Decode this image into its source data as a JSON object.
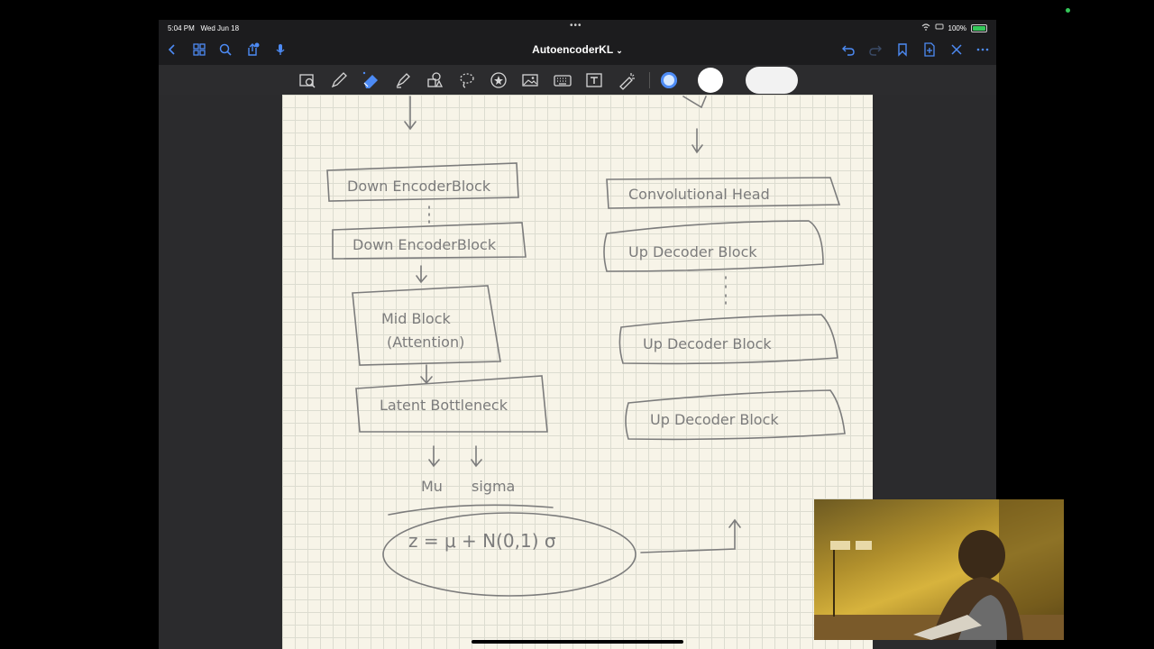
{
  "status_bar": {
    "time": "5:04 PM",
    "date": "Wed Jun 18",
    "battery": "100%",
    "multitask_dots": "•••"
  },
  "nav": {
    "title": "AutoencoderKL",
    "title_chevron": "⌄",
    "accent_color": "#4d8bf5"
  },
  "toolbar": {
    "tools": [
      "zoom-window-icon",
      "pen-icon",
      "eraser-icon",
      "highlighter-icon",
      "shapes-icon",
      "lasso-icon",
      "sticker-icon",
      "image-icon",
      "keyboard-icon",
      "text-icon",
      "laser-pointer-icon"
    ],
    "colors": [
      "#d6e8ff",
      "#ffffff",
      "#f2f2f2"
    ]
  },
  "diagram": {
    "encoder_blocks": [
      "Down EncoderBlock",
      "Down EncoderBlock"
    ],
    "mid_block": [
      "Mid Block",
      "(Attention)"
    ],
    "bottleneck": "Latent Bottleneck",
    "mu": "Mu",
    "sigma": "sigma",
    "reparam": "z = μ + N(0,1) σ",
    "conv_head": "Convolutional Head",
    "decoder_blocks": [
      "Up Decoder Block",
      "Up Decoder Block",
      "Up Decoder Block"
    ]
  }
}
